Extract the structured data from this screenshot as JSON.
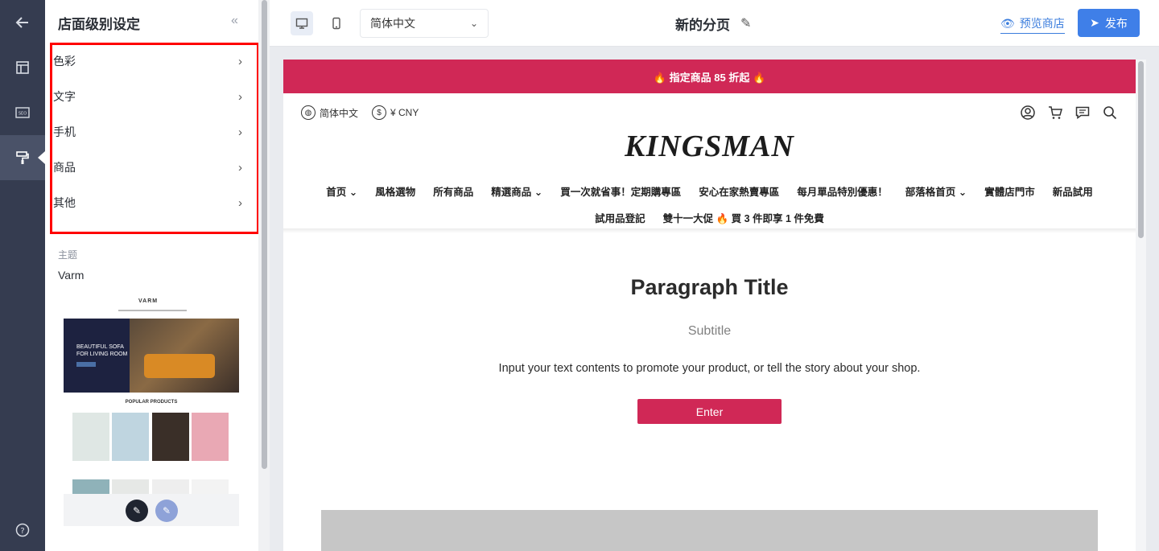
{
  "rail": {
    "items": [
      "back",
      "layout",
      "seo",
      "theme-brush",
      "help"
    ]
  },
  "panel": {
    "title": "店面级别设定",
    "collapse_glyph": "«",
    "menu": [
      {
        "label": "色彩"
      },
      {
        "label": "文字"
      },
      {
        "label": "手机"
      },
      {
        "label": "商品"
      },
      {
        "label": "其他"
      }
    ],
    "theme_label": "主题",
    "theme_name": "Varm",
    "thumbnail": {
      "logo": "VARM",
      "hero_text_1": "BEAUTIFUL SOFA",
      "hero_text_2": "FOR LIVING ROOM",
      "popular": "POPULAR PRODUCTS"
    }
  },
  "topbar": {
    "language": "简体中文",
    "page_title": "新的分页",
    "preview_label": "预览商店",
    "publish_label": "发布"
  },
  "preview": {
    "promo": "🔥 指定商品 85 折起 🔥",
    "util_language": "简体中文",
    "util_currency": "¥ CNY",
    "brand": "KINGSMAN",
    "nav_row1": [
      "首页 ⌄",
      "風格選物",
      "所有商品",
      "精選商品 ⌄",
      "買一次就省事！定期購專區",
      "安心在家熱賣專區",
      "每月單品特別優惠！",
      "部落格首页 ⌄",
      "實體店門市",
      "新品試用"
    ],
    "nav_row2": [
      "試用品登記",
      "雙十一大促 🔥 買 3 件即享 1 件免費"
    ],
    "paragraph_title": "Paragraph Title",
    "subtitle": "Subtitle",
    "body": "Input your text contents to promote your product, or tell the story about your shop.",
    "button": "Enter"
  },
  "colors": {
    "rail_bg": "#353c50",
    "accent_red": "#d02856",
    "publish_blue": "#3f7fe8",
    "highlight_box": "#ff0000"
  }
}
